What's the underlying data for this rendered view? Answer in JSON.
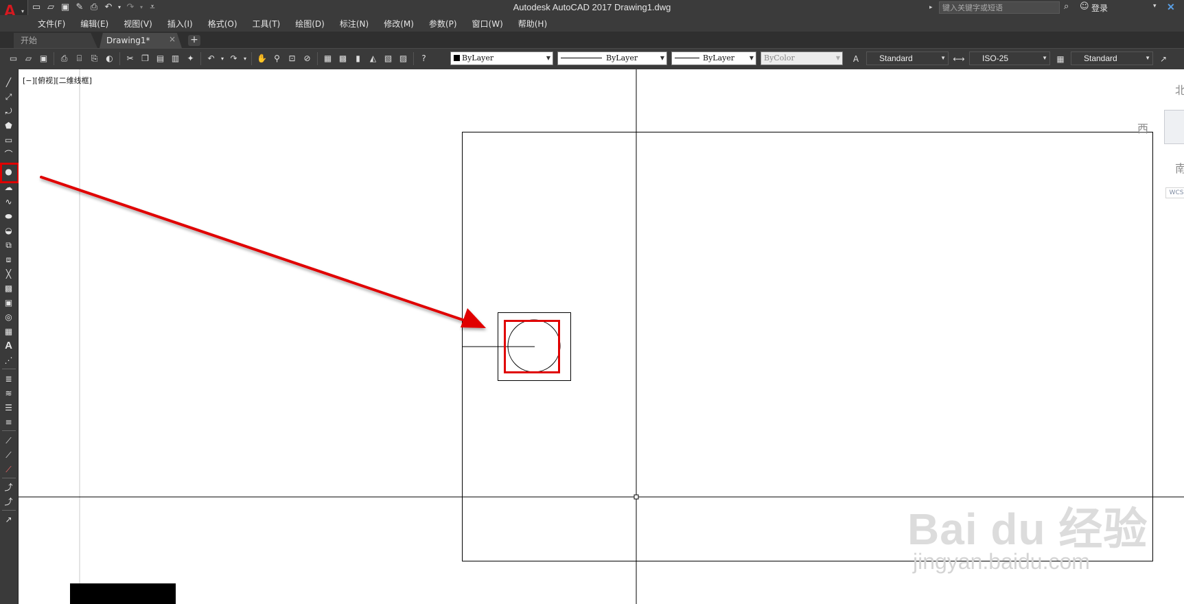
{
  "window": {
    "title": "Autodesk AutoCAD 2017    Drawing1.dwg",
    "search_placeholder": "键入关键字或短语",
    "login": "登录"
  },
  "menus": [
    "文件(F)",
    "编辑(E)",
    "视图(V)",
    "插入(I)",
    "格式(O)",
    "工具(T)",
    "绘图(D)",
    "标注(N)",
    "修改(M)",
    "参数(P)",
    "窗口(W)",
    "帮助(H)"
  ],
  "tabs": {
    "start": "开始",
    "drawing": "Drawing1*",
    "close": "×",
    "add": "+"
  },
  "properties": {
    "color": "ByLayer",
    "linetype": "ByLayer",
    "lineweight": "ByLayer",
    "plotstyle": "ByColor",
    "text_style": "Standard",
    "dim_style": "ISO-25",
    "table_style": "Standard"
  },
  "viewport": {
    "label": "[−][俯视][二维线框]"
  },
  "viewcube": {
    "north": "北",
    "west": "西",
    "south": "南",
    "wcs": "WCS"
  },
  "watermark": {
    "brand": "Bai du 经验",
    "url": "jingyan.baidu.com"
  },
  "colors": {
    "annotation_red": "#e00000",
    "ui_dark": "#3a3a3a",
    "autocad_red": "#d71920"
  },
  "icons": {
    "qat": [
      "new-icon",
      "open-icon",
      "save-icon",
      "saveas-icon",
      "plot-icon",
      "undo-icon",
      "redo-icon",
      "workspace-dropdown-icon"
    ],
    "left_toolbar": [
      "line-icon",
      "construction-line-icon",
      "polyline-icon",
      "polygon-icon",
      "rectangle-icon",
      "arc-icon",
      "circle-icon",
      "revcloud-icon",
      "spline-icon",
      "ellipse-icon",
      "ellipse-arc-icon",
      "insert-block-icon",
      "make-block-icon",
      "point-icon",
      "hatch-icon",
      "gradient-icon",
      "region-icon",
      "table-icon",
      "mtext-icon",
      "add-selected-icon"
    ]
  }
}
